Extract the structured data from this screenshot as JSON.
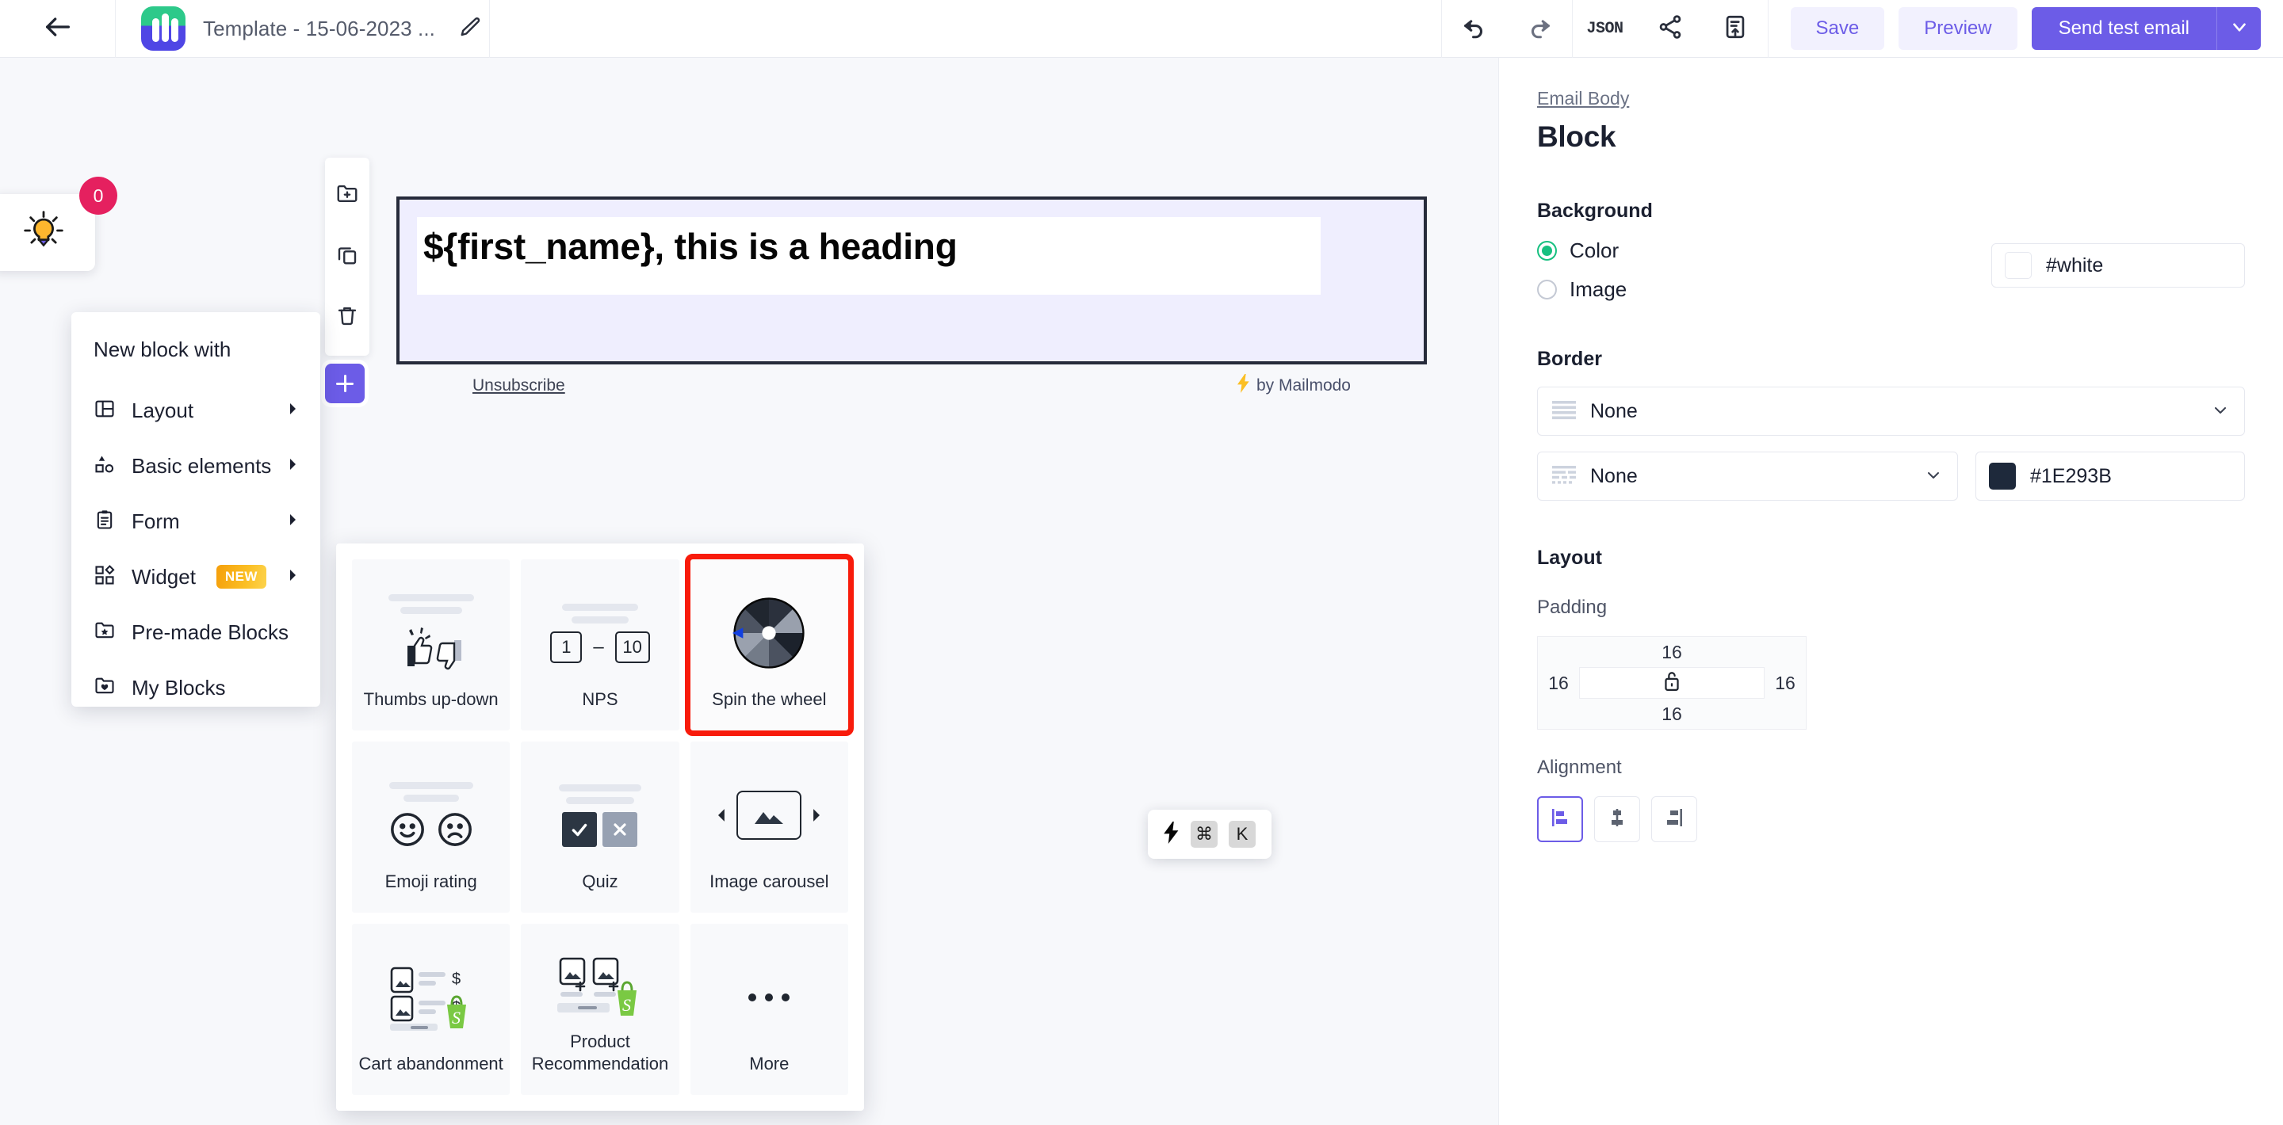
{
  "header": {
    "back_icon": "arrow-left-icon",
    "logo_name": "mailmodo-logo",
    "template_title": "Template - 15-06-2023 ...",
    "edit_icon": "pencil-icon",
    "undo_icon": "undo-icon",
    "redo_icon": "redo-icon",
    "json_label": "JSON",
    "share_icon": "share-icon",
    "export_icon": "export-file-icon",
    "save_label": "Save",
    "preview_label": "Preview",
    "send_test_label": "Send test email",
    "send_caret_icon": "chevron-down-icon",
    "accent": "#6c5ce7",
    "ghost_bg": "#f2f1fe"
  },
  "canvas": {
    "bulb": {
      "icon": "lightbulb-icon",
      "badge_count": "0",
      "badge_color": "#e5205f"
    },
    "block_toolbar": [
      {
        "icon": "folder-plus-icon"
      },
      {
        "icon": "copy-icon"
      },
      {
        "icon": "trash-icon"
      }
    ],
    "add_block_icon": "plus-icon",
    "email": {
      "heading": "${first_name}, this is a heading",
      "unsubscribe_label": "Unsubscribe",
      "footer_brand": "by Mailmodo",
      "footer_brand_icon": "bolt-icon",
      "block_border_color": "#262b3a",
      "block_bg": "#efeefe"
    }
  },
  "block_menu": {
    "title": "New block with",
    "items": [
      {
        "label": "Layout",
        "icon": "layout-icon",
        "has_submenu": true,
        "badge": ""
      },
      {
        "label": "Basic elements",
        "icon": "shapes-icon",
        "has_submenu": true,
        "badge": ""
      },
      {
        "label": "Form",
        "icon": "clipboard-icon",
        "has_submenu": true,
        "badge": ""
      },
      {
        "label": "Widget",
        "icon": "widget-grid-icon",
        "has_submenu": true,
        "badge": "NEW"
      },
      {
        "label": "Pre-made Blocks",
        "icon": "folder-star-icon",
        "has_submenu": false,
        "badge": ""
      },
      {
        "label": "My Blocks",
        "icon": "folder-heart-icon",
        "has_submenu": false,
        "badge": ""
      }
    ]
  },
  "widget_panel": {
    "items": [
      {
        "label": "Thumbs up-down",
        "art": "thumbs",
        "selected": false
      },
      {
        "label": "NPS",
        "art": "nps",
        "selected": false,
        "range_from": "1",
        "range_to": "10"
      },
      {
        "label": "Spin the wheel",
        "art": "wheel",
        "selected": true
      },
      {
        "label": "Emoji rating",
        "art": "emoji",
        "selected": false
      },
      {
        "label": "Quiz",
        "art": "quiz",
        "selected": false
      },
      {
        "label": "Image carousel",
        "art": "carousel",
        "selected": false
      },
      {
        "label": "Cart abandonment",
        "art": "cart",
        "selected": false
      },
      {
        "label": "Product Recommendation",
        "art": "product",
        "selected": false
      },
      {
        "label": "More",
        "art": "more",
        "selected": false
      }
    ],
    "selection_highlight_color": "#f81b0b"
  },
  "right_panel": {
    "breadcrumb": "Email Body",
    "title": "Block",
    "background": {
      "section_label": "Background",
      "option_color": "Color",
      "option_image": "Image",
      "selected": "Color",
      "color_value": "#white",
      "swatch_color": "#ffffff",
      "radio_on_color": "#17c080"
    },
    "border": {
      "section_label": "Border",
      "style_value": "None",
      "style_icon": "border-style-solid-icon",
      "width_value": "None",
      "width_icon": "border-style-dashed-icon",
      "color_value": "#1E293B",
      "swatch_color": "#1E293B",
      "caret_icon": "chevron-down-icon"
    },
    "layout": {
      "section_label": "Layout",
      "padding_label": "Padding",
      "padding_top": "16",
      "padding_right": "16",
      "padding_bottom": "16",
      "padding_left": "16",
      "lock_icon": "unlock-icon",
      "alignment_label": "Alignment",
      "alignment_options": [
        {
          "icon": "align-left-icon",
          "active": true
        },
        {
          "icon": "align-center-icon",
          "active": false
        },
        {
          "icon": "align-right-icon",
          "active": false
        }
      ],
      "active_color": "#6c5ce7"
    }
  },
  "shortcut_hint": {
    "bolt_icon": "bolt-icon",
    "key_cmd": "⌘",
    "key_letter": "K"
  }
}
